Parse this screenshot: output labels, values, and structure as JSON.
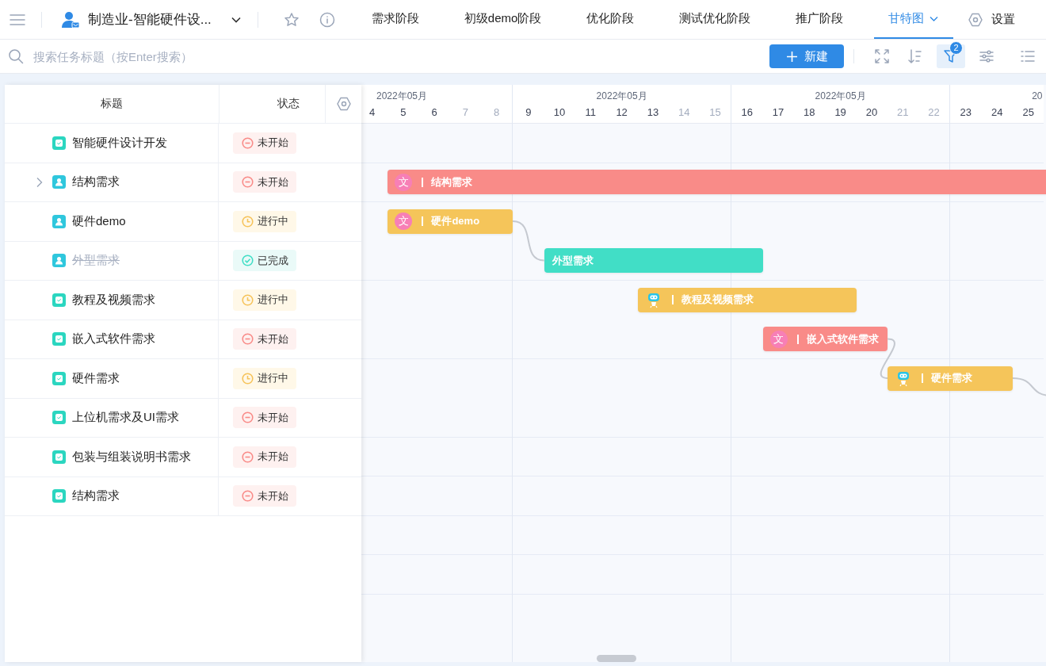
{
  "header": {
    "project_title": "制造业-智能硬件设...",
    "tabs": [
      {
        "label": "需求阶段",
        "selected": false,
        "dropdown": false
      },
      {
        "label": "初级demo阶段",
        "selected": false,
        "dropdown": false
      },
      {
        "label": "优化阶段",
        "selected": false,
        "dropdown": false
      },
      {
        "label": "测试优化阶段",
        "selected": false,
        "dropdown": false
      },
      {
        "label": "推广阶段",
        "selected": false,
        "dropdown": false
      },
      {
        "label": "甘特图",
        "selected": true,
        "dropdown": true
      }
    ],
    "settings": "设置"
  },
  "toolbar": {
    "search": {
      "placeholder": "搜索任务标题（按Enter搜索）"
    },
    "new_button": "新建",
    "filter": {
      "active": true,
      "badge": "2"
    }
  },
  "table": {
    "columns": [
      "标题",
      "状态"
    ],
    "rows": [
      {
        "title": "智能硬件设计开发",
        "kind": "task",
        "expandable": false,
        "done": false,
        "status": {
          "kind": "todo",
          "label": "未开始"
        }
      },
      {
        "title": "结构需求",
        "kind": "user",
        "expandable": true,
        "done": false,
        "status": {
          "kind": "todo",
          "label": "未开始"
        },
        "bar": {
          "label": "结构需求",
          "color": "#f98b88",
          "avatar": {
            "kind": "text",
            "text": "文"
          },
          "link_out": false
        }
      },
      {
        "title": "硬件demo",
        "kind": "user",
        "expandable": false,
        "done": false,
        "status": {
          "kind": "doing",
          "label": "进行中"
        },
        "bar": {
          "label": "硬件demo",
          "color": "#f5c55a",
          "avatar": {
            "kind": "text",
            "text": "文"
          },
          "link_out": true
        }
      },
      {
        "title": "外型需求",
        "kind": "user",
        "expandable": false,
        "done": true,
        "status": {
          "kind": "done",
          "label": "已完成"
        },
        "bar": {
          "label": "外型需求",
          "color": "#41dec6",
          "link_out": false
        }
      },
      {
        "title": "教程及视频需求",
        "kind": "task",
        "expandable": false,
        "done": false,
        "status": {
          "kind": "doing",
          "label": "进行中"
        },
        "bar": {
          "label": "教程及视频需求",
          "color": "#f5c55a",
          "avatar": {
            "kind": "robot"
          },
          "link_out": false
        }
      },
      {
        "title": "嵌入式软件需求",
        "kind": "task",
        "expandable": false,
        "done": false,
        "status": {
          "kind": "todo",
          "label": "未开始"
        },
        "bar": {
          "label": "嵌入式软件需求",
          "color": "#f98b88",
          "avatar": {
            "kind": "text",
            "text": "文"
          },
          "link_out": true
        }
      },
      {
        "title": "硬件需求",
        "kind": "task",
        "expandable": false,
        "done": false,
        "status": {
          "kind": "doing",
          "label": "进行中"
        },
        "bar": {
          "label": "硬件需求",
          "color": "#f5c55a",
          "avatar": {
            "kind": "robot"
          },
          "link_out": true
        }
      },
      {
        "title": "上位机需求及UI需求",
        "kind": "task",
        "expandable": false,
        "done": false,
        "status": {
          "kind": "todo",
          "label": "未开始"
        }
      },
      {
        "title": "包装与组装说明书需求",
        "kind": "task",
        "expandable": false,
        "done": false,
        "status": {
          "kind": "todo",
          "label": "未开始"
        }
      },
      {
        "title": "结构需求",
        "kind": "task",
        "expandable": false,
        "done": false,
        "status": {
          "kind": "todo",
          "label": "未开始"
        }
      }
    ]
  },
  "gantt": {
    "weeks": [
      {
        "label": "2022年05月",
        "days": [
          {
            "day": "4",
            "weekend": false
          },
          {
            "day": "5",
            "weekend": false
          },
          {
            "day": "6",
            "weekend": false
          },
          {
            "day": "7",
            "weekend": true
          },
          {
            "day": "8",
            "weekend": true
          }
        ]
      },
      {
        "label": "2022年05月",
        "days": [
          {
            "day": "9",
            "weekend": false
          },
          {
            "day": "10",
            "weekend": false
          },
          {
            "day": "11",
            "weekend": false
          },
          {
            "day": "12",
            "weekend": false
          },
          {
            "day": "13",
            "weekend": false
          },
          {
            "day": "14",
            "weekend": true
          },
          {
            "day": "15",
            "weekend": true
          }
        ]
      },
      {
        "label": "2022年05月",
        "days": [
          {
            "day": "16",
            "weekend": false
          },
          {
            "day": "17",
            "weekend": false
          },
          {
            "day": "18",
            "weekend": false
          },
          {
            "day": "19",
            "weekend": false
          },
          {
            "day": "20",
            "weekend": false
          },
          {
            "day": "21",
            "weekend": true
          },
          {
            "day": "22",
            "weekend": true
          }
        ]
      },
      {
        "label": "20",
        "days": [
          {
            "day": "23",
            "weekend": false
          },
          {
            "day": "24",
            "weekend": false
          },
          {
            "day": "25",
            "weekend": false
          }
        ]
      }
    ]
  }
}
